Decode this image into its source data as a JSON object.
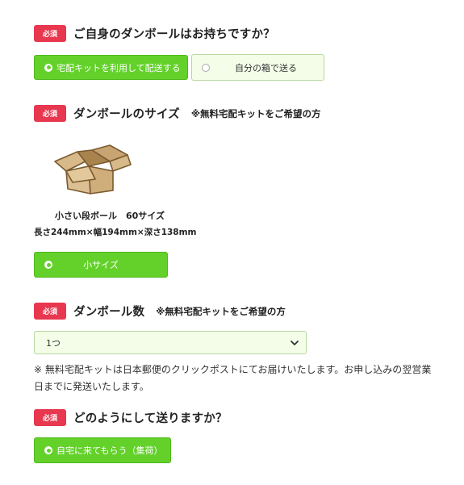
{
  "q1": {
    "badge": "必須",
    "title": "ご自身のダンボールはお持ちですか？",
    "options": [
      {
        "label": "宅配キットを利用して配送する",
        "selected": true
      },
      {
        "label": "自分の箱で送る",
        "selected": false
      }
    ]
  },
  "q2": {
    "badge": "必須",
    "title": "ダンボールのサイズ",
    "note": "※無料宅配キットをご希望の方",
    "box_icon": "cardboard-box-icon",
    "box_name": "小さい段ボール　60サイズ",
    "box_dims": "長さ244mm×幅194mm×深さ138mm",
    "options": [
      {
        "label": "小サイズ",
        "selected": true
      }
    ]
  },
  "q3": {
    "badge": "必須",
    "title": "ダンボール数",
    "note": "※無料宅配キットをご希望の方",
    "select_value": "1つ",
    "notice": "※ 無料宅配キットは日本郵便のクリックポストにてお届けいたします。お申し込みの翌営業日までに発送いたします。"
  },
  "q4": {
    "badge": "必須",
    "title": "どのようにして送りますか？",
    "options": [
      {
        "label": "自宅に来てもらう（集荷）",
        "selected": true
      }
    ]
  },
  "colors": {
    "badge": "#e8384f",
    "selected": "#63d12a",
    "unselected_bg": "#f3fde8",
    "box": "#d8b98a"
  }
}
